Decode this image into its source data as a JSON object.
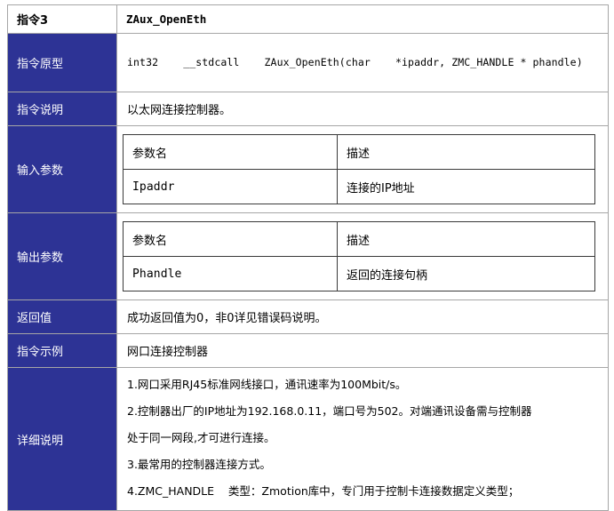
{
  "header": {
    "label": "指令3",
    "name": "ZAux_OpenEth"
  },
  "rows": {
    "prototype": {
      "label": "指令原型",
      "text": "int32    __stdcall    ZAux_OpenEth(char    *ipaddr, ZMC_HANDLE * phandle)"
    },
    "description": {
      "label": "指令说明",
      "text": "以太网连接控制器。"
    },
    "input_params": {
      "label": "输入参数",
      "col_name": "参数名",
      "col_desc": "描述",
      "param_name": "Ipaddr",
      "param_desc": "连接的IP地址"
    },
    "output_params": {
      "label": "输出参数",
      "col_name": "参数名",
      "col_desc": "描述",
      "param_name": "Phandle",
      "param_desc": "返回的连接句柄"
    },
    "return_value": {
      "label": "返回值",
      "text": "成功返回值为0，非0详见错误码说明。"
    },
    "example": {
      "label": "指令示例",
      "text": "网口连接控制器"
    },
    "details": {
      "label": "详细说明",
      "line1": "1.网口采用RJ45标准网线接口，通讯速率为100Mbit/s。",
      "line2": "2.控制器出厂的IP地址为192.168.0.11，端口号为502。对端通讯设备需与控制器",
      "line3": "处于同一网段,才可进行连接。",
      "line4": "3.最常用的控制器连接方式。",
      "line5": "4.ZMC_HANDLE    类型：Zmotion库中，专门用于控制卡连接数据定义类型；"
    }
  },
  "colors": {
    "label_bg": "#2d3395",
    "label_text": "#ffffff",
    "border": "#a6a6a6"
  }
}
